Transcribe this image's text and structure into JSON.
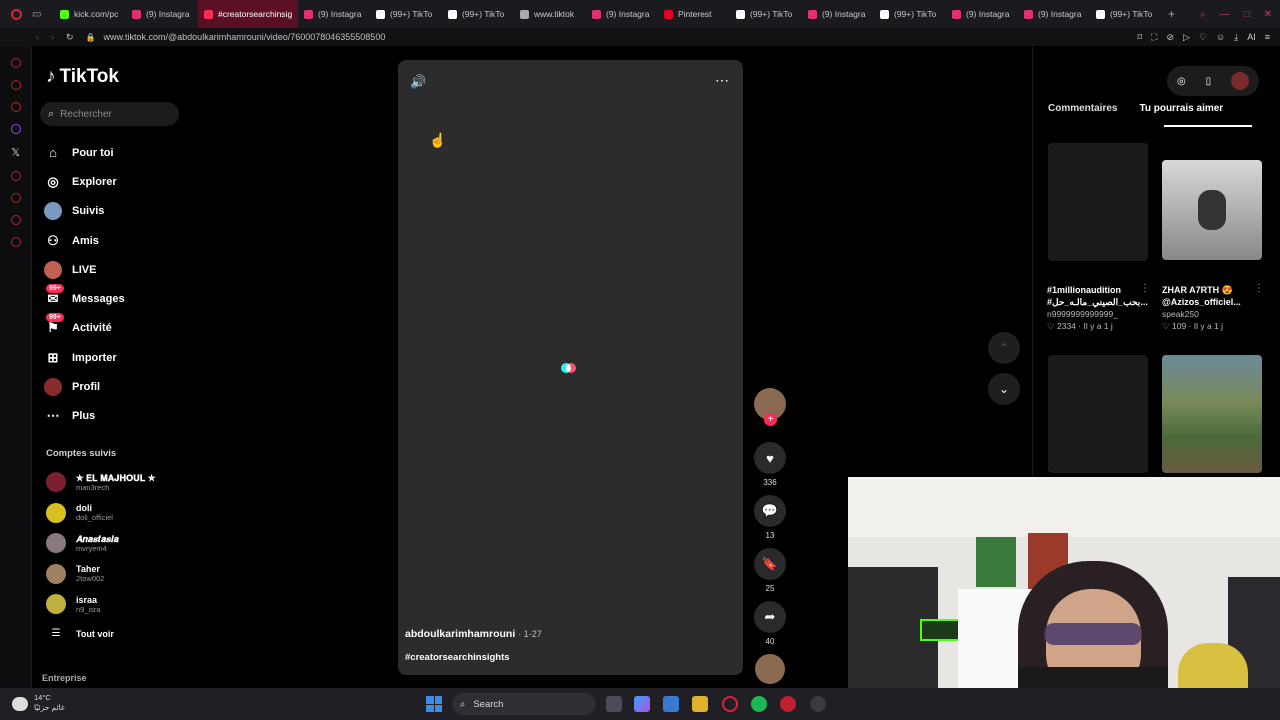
{
  "browser": {
    "tabs": [
      {
        "label": "kick.com/pc",
        "color": "#53fc18"
      },
      {
        "label": "(9) Instagra",
        "color": "#e1306c"
      },
      {
        "label": "#creatorsearchinsig",
        "color": "#fe2c55",
        "active": true
      },
      {
        "label": "(9) Instagra",
        "color": "#e1306c"
      },
      {
        "label": "(99+) TikTo",
        "color": "#ffffff"
      },
      {
        "label": "(99+) TikTo",
        "color": "#ffffff"
      },
      {
        "label": "www.tiktok",
        "color": "#aaaaaa"
      },
      {
        "label": "(9) Instagra",
        "color": "#e1306c"
      },
      {
        "label": "Pinterest",
        "color": "#e60023"
      },
      {
        "label": "(99+) TikTo",
        "color": "#ffffff"
      },
      {
        "label": "(9) Instagra",
        "color": "#e1306c"
      },
      {
        "label": "(99+) TikTo",
        "color": "#ffffff"
      },
      {
        "label": "(9) Instagra",
        "color": "#e1306c"
      },
      {
        "label": "(9) Instagra",
        "color": "#e1306c"
      },
      {
        "label": "(99+) TikTo",
        "color": "#ffffff"
      }
    ],
    "url": "www.tiktok.com/@abdoulkarimhamrouni/video/7600078046355508500",
    "ai_label": "AI"
  },
  "tiktok": {
    "logo": "TikTok",
    "search_placeholder": "Rechercher",
    "nav": [
      {
        "label": "Pour toi",
        "icon": "home-icon"
      },
      {
        "label": "Explorer",
        "icon": "compass-icon"
      },
      {
        "label": "Suivis",
        "icon": "following-avatar"
      },
      {
        "label": "Amis",
        "icon": "friends-icon"
      },
      {
        "label": "LIVE",
        "icon": "live-avatar"
      },
      {
        "label": "Messages",
        "icon": "messages-icon",
        "badge": "99+"
      },
      {
        "label": "Activité",
        "icon": "activity-icon",
        "badge": "99+"
      },
      {
        "label": "Importer",
        "icon": "upload-icon"
      },
      {
        "label": "Profil",
        "icon": "profile-avatar"
      },
      {
        "label": "Plus",
        "icon": "more-icon"
      }
    ],
    "following_title": "Comptes suivis",
    "following": [
      {
        "name": "✯ 𝐄𝐋 𝐌𝐀𝐉𝐇𝐎𝐔𝐋 ✯",
        "handle": "man3rech",
        "color": "#7a2030"
      },
      {
        "name": "doli",
        "handle": "doli_officiel",
        "color": "#d8c020"
      },
      {
        "name": "𝑨𝒏𝒂𝒔𝒕𝒂𝒔𝒊𝒂",
        "handle": "mvryem4",
        "color": "#8a7a80"
      },
      {
        "name": "Taher",
        "handle": "2tow002",
        "color": "#a08060"
      },
      {
        "name": "israa",
        "handle": "n9_isra",
        "color": "#c0b040"
      }
    ],
    "see_all": "Tout voir",
    "enterprise": "Entreprise",
    "video": {
      "author": "abdoulkarimhamrouni",
      "date": "· 1-27",
      "hashtag": "#creatorsearchinsights"
    },
    "actions": {
      "likes": "336",
      "comments": "13",
      "saves": "25",
      "shares": "40"
    },
    "panel_tabs": [
      "Commentaires",
      "Tu pourrais aimer"
    ],
    "suggestions": [
      {
        "title": "#1millionaudition #بحب_الصيني_مالـه_حل...",
        "user": "n9999999999999_",
        "likes": "2334",
        "age": "Il y a 1 j"
      },
      {
        "title": "ZHAR A7RTH 😍 @Azizos_officiel...",
        "user": "speak250",
        "likes": "109",
        "age": "Il y a 1 j"
      }
    ]
  },
  "taskbar": {
    "weather_temp": "14°C",
    "weather_desc": "غائم جزئيًا",
    "search_label": "Search"
  }
}
